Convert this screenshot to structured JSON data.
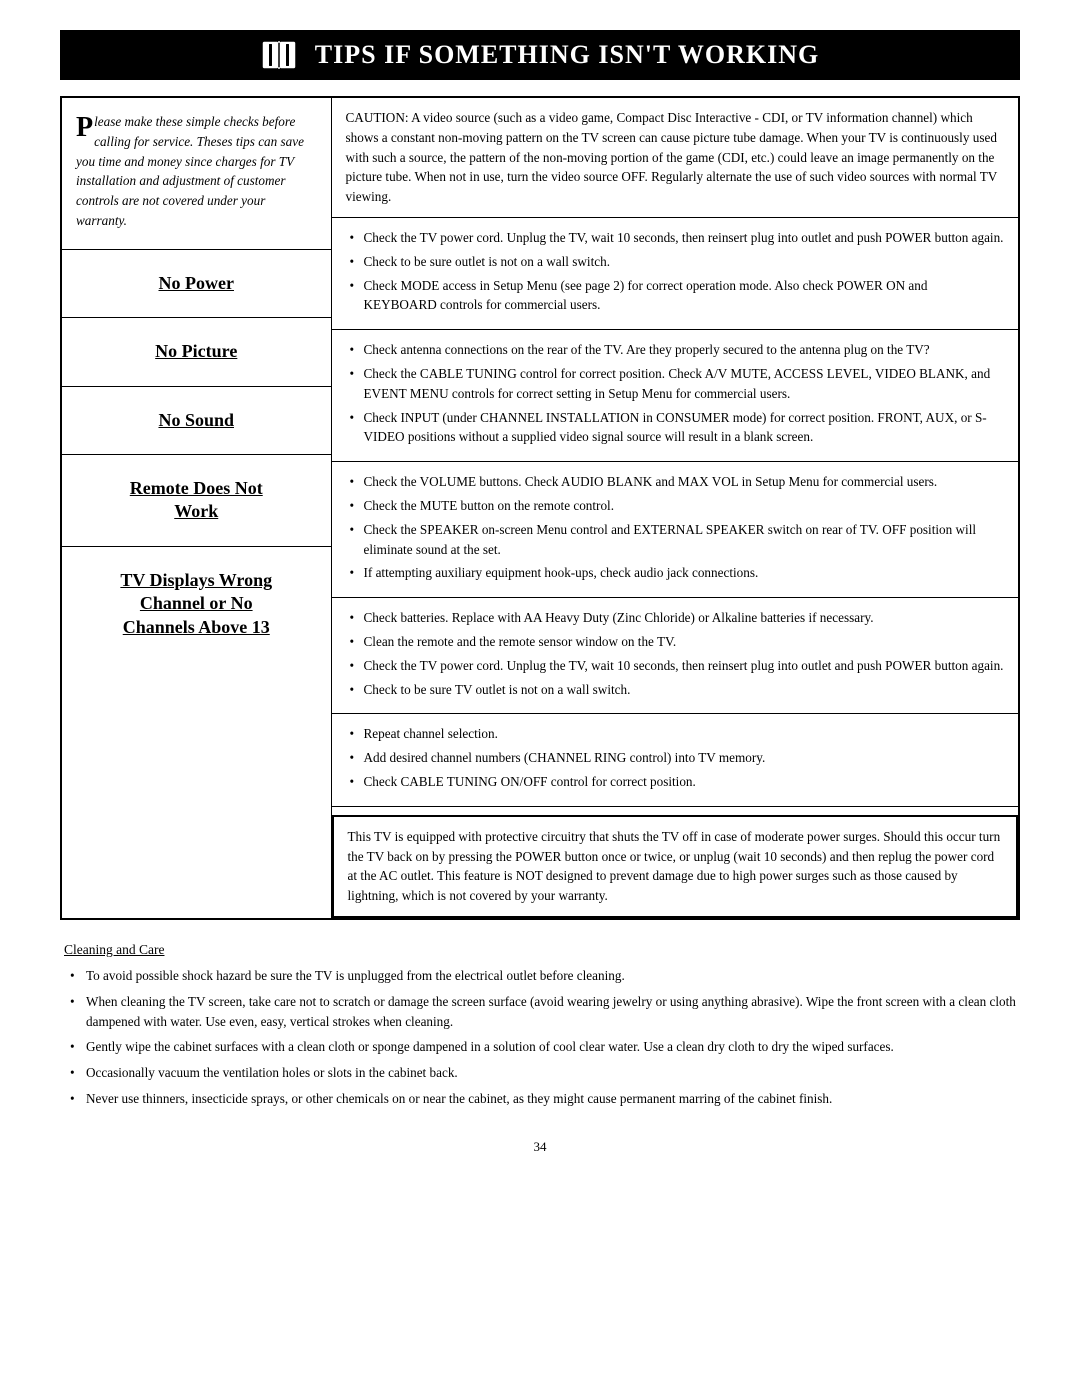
{
  "header": {
    "title": "Tips If Something Isn't Working",
    "title_display": "TIPS IF SOMETHING ISN'T WORKING"
  },
  "intro": {
    "drop_cap": "P",
    "text": "lease make these simple checks before calling for service.  Theses tips can save you time and money since charges for TV installation and adjustment of customer controls are not covered under your warranty."
  },
  "sections": [
    {
      "label": "No Power",
      "bullets": [
        "Check the TV power cord.  Unplug the TV, wait 10 seconds, then reinsert plug into outlet and push POWER button again.",
        "Check to be sure outlet is not on a wall switch.",
        "Check MODE access in Setup Menu (see page 2) for correct operation mode. Also check POWER ON and KEYBOARD controls for commercial users."
      ]
    },
    {
      "label": "No Picture",
      "bullets": [
        "Check antenna connections on the rear of the TV.  Are they properly secured to the antenna plug on the TV?",
        "Check the CABLE TUNING control for correct position. Check A/V MUTE, ACCESS LEVEL, VIDEO BLANK, and EVENT MENU controls for correct setting in Setup Menu for commercial users.",
        "Check INPUT (under CHANNEL INSTALLATION in CONSUMER mode) for correct position. FRONT, AUX, or S-VIDEO positions without a supplied video signal source will result in a blank screen."
      ]
    },
    {
      "label": "No Sound",
      "bullets": [
        "Check the VOLUME buttons. Check AUDIO BLANK and MAX VOL in Setup Menu for commercial users.",
        "Check the MUTE button on the remote control.",
        "Check the SPEAKER on-screen Menu control and EXTERNAL SPEAKER switch on rear of TV. OFF position will eliminate sound at the set.",
        "If attempting auxiliary equipment hook-ups, check audio jack connections."
      ]
    },
    {
      "label": "Remote Does Not Work",
      "label_line1": "Remote Does Not",
      "label_line2": "Work",
      "bullets": [
        "Check batteries.  Replace with AA Heavy Duty (Zinc Chloride) or Alkaline batteries if necessary.",
        "Clean the remote and the remote sensor window on the TV.",
        "Check the TV power cord.  Unplug the TV, wait 10 seconds, then reinsert plug into outlet and push POWER button again.",
        "Check to be sure TV outlet is not on a wall switch."
      ]
    },
    {
      "label": "TV Displays Wrong Channel or No Channels Above 13",
      "label_line1": "TV Displays Wrong",
      "label_line2": "Channel or No",
      "label_line3": "Channels Above 13",
      "bullets": [
        "Repeat channel selection.",
        "Add desired channel numbers (CHANNEL RING control) into TV memory.",
        "Check CABLE TUNING ON/OFF control for correct position."
      ]
    }
  ],
  "caution": {
    "text": "CAUTION: A video source (such as a video game, Compact Disc Interactive - CDI, or TV information channel) which shows a constant non-moving pattern on the TV screen can cause picture tube damage.  When your TV is continuously used with such a source, the pattern of the non-moving portion of the game (CDI, etc.) could leave an image permanently on the picture tube.  When not in use, turn the video source OFF.  Regularly alternate the use of such video sources with normal TV viewing."
  },
  "power_surge": {
    "text": "This TV is equipped with protective circuitry that shuts the TV off in case of moderate power surges.  Should this occur turn the TV back on by pressing the POWER button once or twice, or unplug (wait 10 seconds) and then replug the power cord at the AC outlet. This feature is NOT designed to prevent damage due to high power surges such as those caused by lightning, which is not covered by your warranty."
  },
  "cleaning": {
    "title": "Cleaning and Care",
    "bullets": [
      "To avoid possible shock hazard be sure the TV is unplugged from the electrical outlet before cleaning.",
      "When cleaning the TV screen, take care not to scratch or damage the screen surface (avoid wearing jewelry or using anything abrasive).  Wipe the front screen with a clean cloth dampened with water.  Use even, easy, vertical strokes when cleaning.",
      "Gently wipe the cabinet surfaces with a clean cloth or sponge dampened in a solution of cool clear water.  Use a clean dry cloth to dry the wiped surfaces.",
      "Occasionally vacuum the ventilation holes or slots in the cabinet back.",
      "Never use thinners, insecticide sprays, or other chemicals on or near the cabinet, as they might cause permanent marring of the cabinet finish."
    ]
  },
  "page_number": "34"
}
